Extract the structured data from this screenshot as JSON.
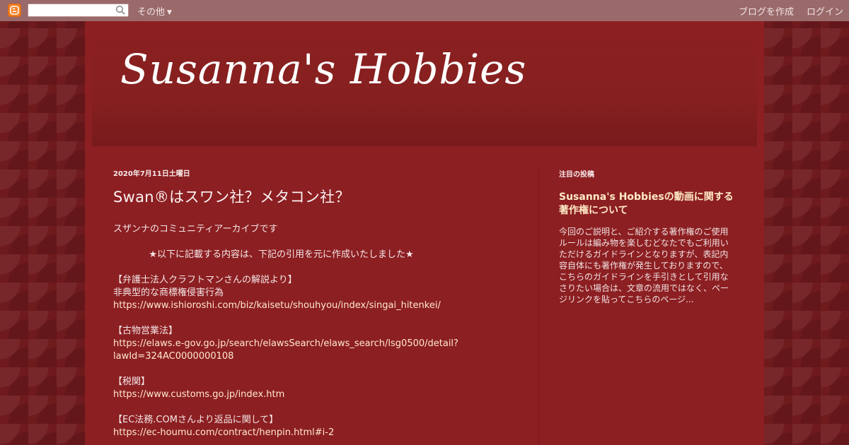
{
  "navbar": {
    "more_label": "その他",
    "create_blog": "ブログを作成",
    "login": "ログイン"
  },
  "blog": {
    "title": "Susanna's Hobbies"
  },
  "post": {
    "date": "2020年7月11日土曜日",
    "title": "Swan®はスワン社？メタコン社？",
    "lines": [
      "スザンナのコミュニティアーカイブです",
      "",
      "★以下に記載する内容は、下記の引用を元に作成いたしました★",
      "",
      "【弁護士法人クラフトマンさんの解説より】",
      "非典型的な商標権侵害行為",
      "https://www.ishioroshi.com/biz/kaisetu/shouhyou/index/singai_hitenkei/",
      "",
      "【古物営業法】",
      "https://elaws.e-gov.go.jp/search/elawsSearch/elaws_search/lsg0500/detail?",
      "lawId=324AC0000000108",
      "",
      "【税関】",
      "https://www.customs.go.jp/index.htm",
      "",
      "【EC法務.COMさんより返品に関して】",
      "https://ec-houmu.com/contract/henpin.html#i-2"
    ]
  },
  "sidebar": {
    "widget_title": "注目の投稿",
    "featured_title": "Susanna's Hobbiesの動画に関する著作権について",
    "featured_snippet": "今回のご説明と、ご紹介する著作権のご使用ルールは編み物を楽しむどなたでもご利用いただけるガイドラインとなりますが、表記内容自体にも著作権が発生しておりますので、こちらのガイドラインを手引きとして引用なさりたい場合は、文章の流用ではなく、ページリンクを貼ってこちらのページ..."
  },
  "colors": {
    "page_bg": "#6f1a1d",
    "content_bg": "#8c1f22",
    "link": "#ffe9c9",
    "featured_title": "#ffeac6"
  }
}
